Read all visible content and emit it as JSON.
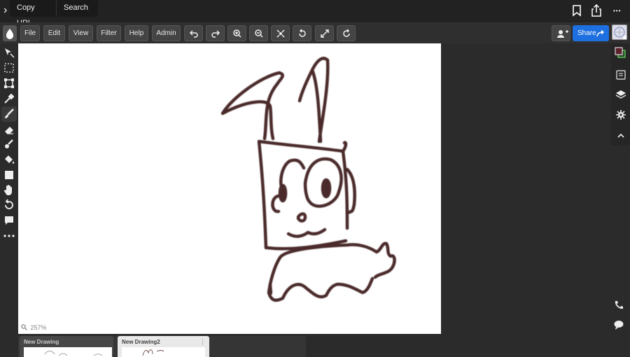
{
  "browser": {
    "expand_label": "›",
    "copy_url": "Copy URL",
    "search": "Search",
    "more_label": "•••"
  },
  "menu": {
    "file": "File",
    "edit": "Edit",
    "view": "View",
    "filter": "Filter",
    "help": "Help",
    "admin": "Admin"
  },
  "share": {
    "label": "Share"
  },
  "canvas": {
    "zoom_value": "257%"
  },
  "tabs": [
    {
      "name": "New Drawing"
    },
    {
      "name": "New Drawing2",
      "menu_label": "⋮"
    }
  ],
  "colors": {
    "accent": "#1e6fe0",
    "ink": "#4a2a2a",
    "canvas": "#ffffff",
    "background": "#2b2b2b"
  },
  "icons": {
    "left_tools": [
      "move-tool-icon",
      "select-rect-icon",
      "transform-icon",
      "eyedropper-icon",
      "brush-icon",
      "eraser-icon",
      "smudge-icon",
      "fill-bucket-icon",
      "shape-icon",
      "hand-icon",
      "rotate-icon",
      "comment-icon",
      "more-tools-icon"
    ],
    "right_tools": [
      "color-swatch-icon",
      "browser-panel-icon",
      "layers-icon",
      "settings-icon",
      "collapse-icon",
      "phone-icon",
      "chat-icon"
    ]
  }
}
